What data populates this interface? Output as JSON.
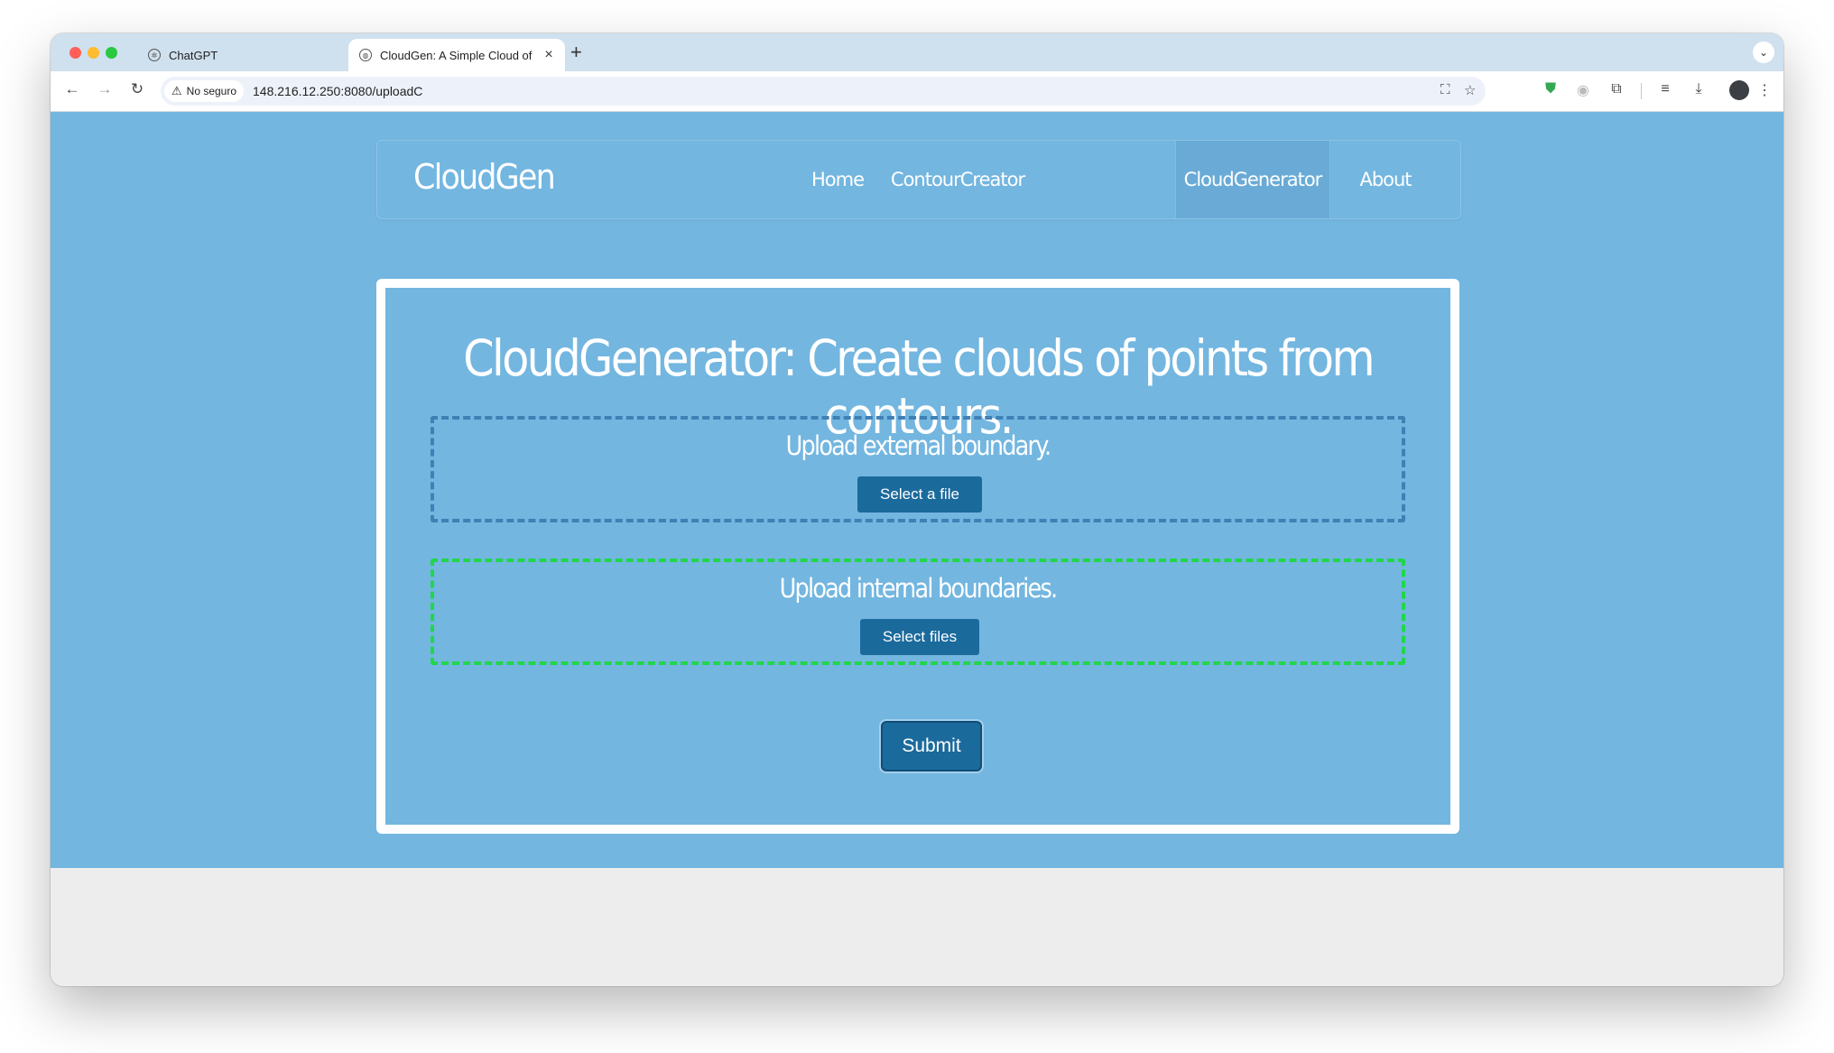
{
  "browser": {
    "tabs": [
      {
        "title": "ChatGPT",
        "close": "×"
      },
      {
        "title": "CloudGen: A Simple Cloud of",
        "close": "×"
      }
    ],
    "new_tab": "+",
    "security_label": "No seguro",
    "url": "148.216.12.250:8080/uploadC",
    "icons": {
      "back": "back-arrow-icon",
      "forward": "forward-arrow-icon",
      "reload": "reload-icon",
      "translate": "translate-icon",
      "bookmark": "star-icon",
      "extension_shield": "shield-icon",
      "extensions": "puzzle-icon",
      "media": "media-controls-icon",
      "download": "download-icon",
      "menu": "kebab-menu-icon"
    }
  },
  "site": {
    "brand": "CloudGen",
    "nav": [
      {
        "label": "Home",
        "active": false
      },
      {
        "label": "ContourCreator",
        "active": false
      },
      {
        "label": "CloudGenerator",
        "active": true
      },
      {
        "label": "About",
        "active": false
      }
    ],
    "title": "CloudGenerator: Create clouds of points from contours.",
    "external": {
      "label": "Upload external boundary.",
      "button": "Select a file"
    },
    "internal": {
      "label": "Upload internal boundaries.",
      "button": "Select files"
    },
    "submit": "Submit"
  },
  "colors": {
    "page_bg": "#73b6e0",
    "button_bg": "#1b6a9c",
    "external_border": "#3f80b5",
    "internal_border": "#21d64b"
  }
}
